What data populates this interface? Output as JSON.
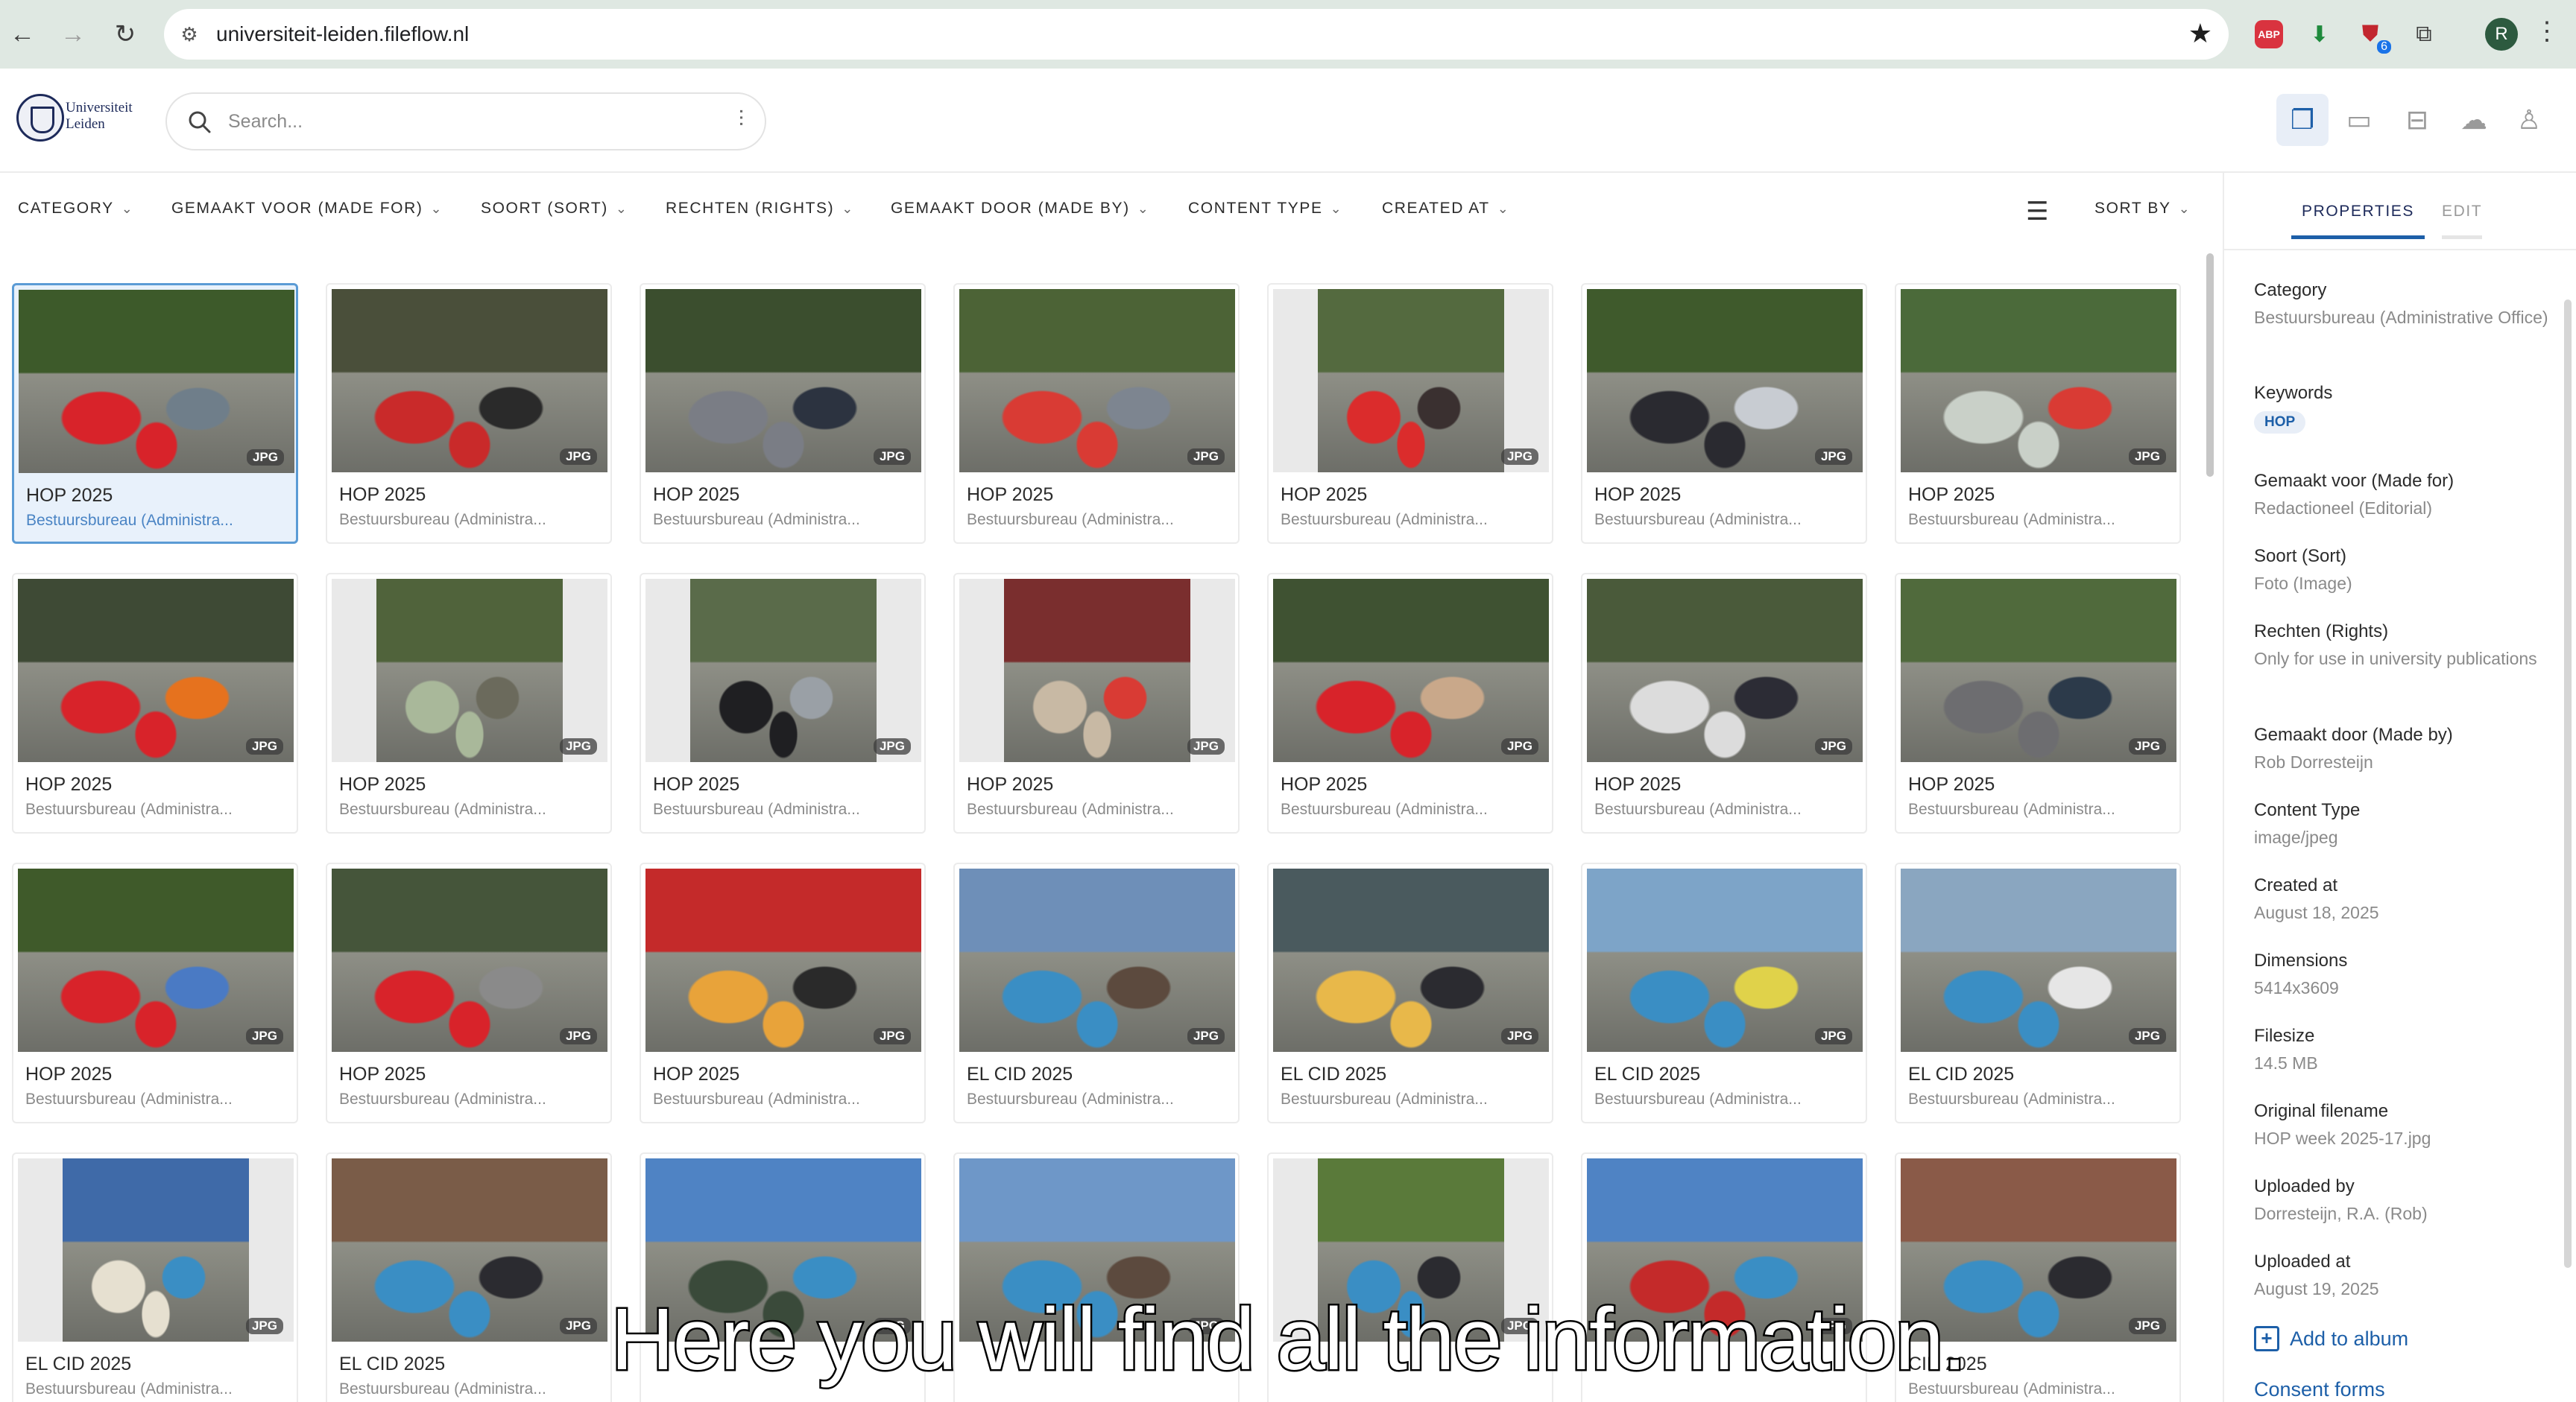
{
  "browser": {
    "url": "universiteit-leiden.fileflow.nl",
    "profile_initial": "R",
    "extension_badge": "6",
    "abp_label": "ABP"
  },
  "header": {
    "logo_text_line1": "Universiteit",
    "logo_text_line2": "Leiden",
    "search_placeholder": "Search..."
  },
  "filters": [
    {
      "label": "CATEGORY"
    },
    {
      "label": "GEMAAKT VOOR (MADE FOR)"
    },
    {
      "label": "SOORT (SORT)"
    },
    {
      "label": "RECHTEN (RIGHTS)"
    },
    {
      "label": "GEMAAKT DOOR (MADE BY)"
    },
    {
      "label": "CONTENT TYPE"
    },
    {
      "label": "CREATED AT"
    }
  ],
  "sort_label": "SORT BY",
  "cards": [
    {
      "title": "HOP 2025",
      "sub": "Bestuursbureau (Administra...",
      "tag": "JPG",
      "portrait": false,
      "palette": [
        "#3d5a2a",
        "#d8232a",
        "#6f7e8a"
      ]
    },
    {
      "title": "HOP 2025",
      "sub": "Bestuursbureau (Administra...",
      "tag": "JPG",
      "portrait": false,
      "palette": [
        "#4a4f3a",
        "#c92a2a",
        "#2a2a2a"
      ]
    },
    {
      "title": "HOP 2025",
      "sub": "Bestuursbureau (Administra...",
      "tag": "JPG",
      "portrait": false,
      "palette": [
        "#3b4e2e",
        "#7a7d85",
        "#2c3340"
      ]
    },
    {
      "title": "HOP 2025",
      "sub": "Bestuursbureau (Administra...",
      "tag": "JPG",
      "portrait": false,
      "palette": [
        "#4c6336",
        "#d93b34",
        "#7d8590"
      ]
    },
    {
      "title": "HOP 2025",
      "sub": "Bestuursbureau (Administra...",
      "tag": "JPG",
      "portrait": true,
      "palette": [
        "#546a3f",
        "#db2c2c",
        "#3a3030"
      ]
    },
    {
      "title": "HOP 2025",
      "sub": "Bestuursbureau (Administra...",
      "tag": "JPG",
      "portrait": false,
      "palette": [
        "#3f5a2c",
        "#2a2a30",
        "#c8ccd2"
      ]
    },
    {
      "title": "HOP 2025",
      "sub": "Bestuursbureau (Administra...",
      "tag": "JPG",
      "portrait": false,
      "palette": [
        "#4b6a3a",
        "#c9d0c8",
        "#d93b34"
      ]
    },
    {
      "title": "HOP 2025",
      "sub": "Bestuursbureau (Administra...",
      "tag": "JPG",
      "portrait": false,
      "palette": [
        "#3e4a35",
        "#d8232a",
        "#e6721e"
      ]
    },
    {
      "title": "HOP 2025",
      "sub": "Bestuursbureau (Administra...",
      "tag": "JPG",
      "portrait": true,
      "palette": [
        "#50633b",
        "#a9b89a",
        "#6b6a5c"
      ]
    },
    {
      "title": "HOP 2025",
      "sub": "Bestuursbureau (Administra...",
      "tag": "JPG",
      "portrait": true,
      "palette": [
        "#5a6b4a",
        "#1f1f22",
        "#9aa0a6"
      ]
    },
    {
      "title": "HOP 2025",
      "sub": "Bestuursbureau (Administra...",
      "tag": "JPG",
      "portrait": true,
      "palette": [
        "#7a2e2e",
        "#c8b9a4",
        "#d93b34"
      ]
    },
    {
      "title": "HOP 2025",
      "sub": "Bestuursbureau (Administra...",
      "tag": "JPG",
      "portrait": false,
      "palette": [
        "#3f5232",
        "#d8232a",
        "#c9a88a"
      ]
    },
    {
      "title": "HOP 2025",
      "sub": "Bestuursbureau (Administra...",
      "tag": "JPG",
      "portrait": false,
      "palette": [
        "#4a5a3a",
        "#dcdcdc",
        "#2c2c35"
      ]
    },
    {
      "title": "HOP 2025",
      "sub": "Bestuursbureau (Administra...",
      "tag": "JPG",
      "portrait": false,
      "palette": [
        "#506a3c",
        "#6d6d70",
        "#2c3a4a"
      ]
    },
    {
      "title": "HOP 2025",
      "sub": "Bestuursbureau (Administra...",
      "tag": "JPG",
      "portrait": false,
      "palette": [
        "#3f5a2a",
        "#d8232a",
        "#4a7ac4"
      ]
    },
    {
      "title": "HOP 2025",
      "sub": "Bestuursbureau (Administra...",
      "tag": "JPG",
      "portrait": false,
      "palette": [
        "#45553a",
        "#d8232a",
        "#8a8a8a"
      ]
    },
    {
      "title": "HOP 2025",
      "sub": "Bestuursbureau (Administra...",
      "tag": "JPG",
      "portrait": false,
      "palette": [
        "#c42a2a",
        "#e8a33a",
        "#2a2a2a"
      ]
    },
    {
      "title": "EL CID 2025",
      "sub": "Bestuursbureau (Administra...",
      "tag": "JPG",
      "portrait": false,
      "palette": [
        "#6e8fb8",
        "#3a8ec4",
        "#5c4a3e"
      ]
    },
    {
      "title": "EL CID 2025",
      "sub": "Bestuursbureau (Administra...",
      "tag": "JPG",
      "portrait": false,
      "palette": [
        "#4a5a5e",
        "#e8b84a",
        "#2b2b30"
      ]
    },
    {
      "title": "EL CID 2025",
      "sub": "Bestuursbureau (Administra...",
      "tag": "JPG",
      "portrait": false,
      "palette": [
        "#7da4c8",
        "#3a8ec4",
        "#e0d24a"
      ]
    },
    {
      "title": "EL CID 2025",
      "sub": "Bestuursbureau (Administra...",
      "tag": "JPG",
      "portrait": false,
      "palette": [
        "#8aa6c0",
        "#3a8ec4",
        "#e6e6e6"
      ]
    },
    {
      "title": "EL CID 2025",
      "sub": "Bestuursbureau (Administra...",
      "tag": "JPG",
      "portrait": true,
      "palette": [
        "#3f6aa8",
        "#e6e0d0",
        "#3a8ec4"
      ]
    },
    {
      "title": "EL CID 2025",
      "sub": "Bestuursbureau (Administra...",
      "tag": "JPG",
      "portrait": false,
      "palette": [
        "#7a5c48",
        "#3a8ec4",
        "#2b2b30"
      ]
    },
    {
      "title": "",
      "sub": "",
      "tag": "JPG",
      "portrait": false,
      "palette": [
        "#4f83c4",
        "#3a4a3a",
        "#3a8ec4"
      ]
    },
    {
      "title": "",
      "sub": "",
      "tag": "JPG",
      "portrait": false,
      "palette": [
        "#6e97c8",
        "#3a8ec4",
        "#5c4a3e"
      ]
    },
    {
      "title": "",
      "sub": "",
      "tag": "JPG",
      "portrait": true,
      "palette": [
        "#5a7a3a",
        "#3a8ec4",
        "#2b2b30"
      ]
    },
    {
      "title": "",
      "sub": "",
      "tag": "JPG",
      "portrait": false,
      "palette": [
        "#4f83c4",
        "#c42a2a",
        "#3a8ec4"
      ]
    },
    {
      "title": "CID 2025",
      "sub": "Bestuursbureau (Administra...",
      "tag": "JPG",
      "portrait": false,
      "palette": [
        "#8a5a48",
        "#3a8ec4",
        "#2b2b30"
      ]
    }
  ],
  "panel": {
    "tab_properties": "PROPERTIES",
    "tab_edit": "EDIT",
    "category_label": "Category",
    "category_value": "Bestuursbureau (Administrative Office)",
    "keywords_label": "Keywords",
    "keyword": "HOP",
    "made_for_label": "Gemaakt voor (Made for)",
    "made_for_value": "Redactioneel (Editorial)",
    "sort_label": "Soort (Sort)",
    "sort_value": "Foto (Image)",
    "rights_label": "Rechten (Rights)",
    "rights_value": "Only for use in university publications",
    "made_by_label": "Gemaakt door (Made by)",
    "made_by_value": "Rob Dorresteijn",
    "content_type_label": "Content Type",
    "content_type_value": "image/jpeg",
    "created_at_label": "Created at",
    "created_at_value": "August 18, 2025",
    "dimensions_label": "Dimensions",
    "dimensions_value": "5414x3609",
    "filesize_label": "Filesize",
    "filesize_value": "14.5 MB",
    "original_filename_label": "Original filename",
    "original_filename_value": "HOP week 2025-17.jpg",
    "uploaded_by_label": "Uploaded by",
    "uploaded_by_value": "Dorresteijn, R.A. (Rob)",
    "uploaded_at_label": "Uploaded at",
    "uploaded_at_value": "August 19, 2025",
    "add_to_album": "Add to album",
    "consent_forms": "Consent forms"
  },
  "subtitle": "Here you will find all the information."
}
